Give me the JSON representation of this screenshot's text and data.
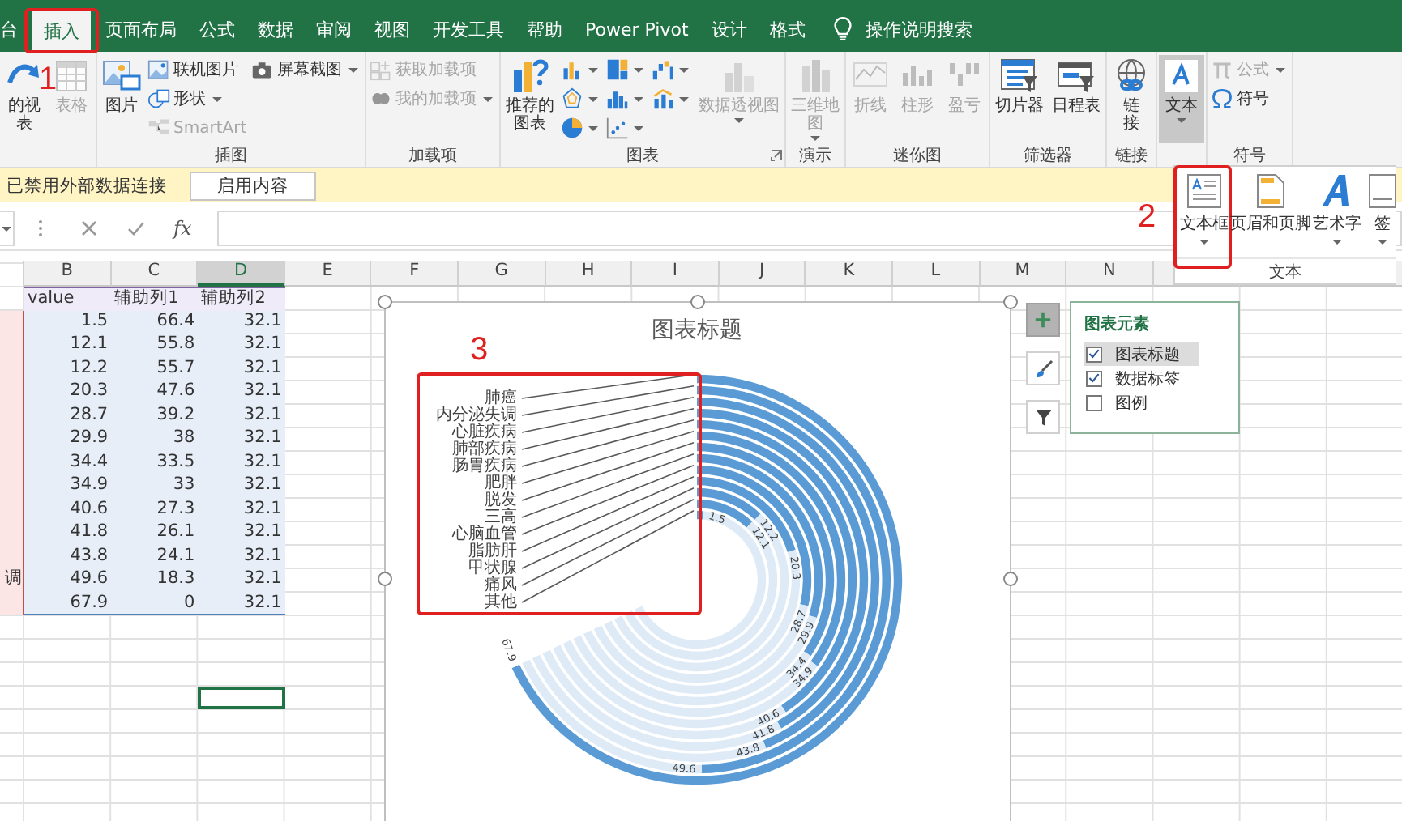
{
  "tabs": [
    {
      "label": "台",
      "selected": false
    },
    {
      "label": "插入",
      "selected": true
    },
    {
      "label": "页面布局",
      "selected": false
    },
    {
      "label": "公式",
      "selected": false
    },
    {
      "label": "数据",
      "selected": false
    },
    {
      "label": "审阅",
      "selected": false
    },
    {
      "label": "视图",
      "selected": false
    },
    {
      "label": "开发工具",
      "selected": false
    },
    {
      "label": "帮助",
      "selected": false
    },
    {
      "label": "Power Pivot",
      "selected": false
    },
    {
      "label": "设计",
      "selected": false
    },
    {
      "label": "格式",
      "selected": false
    }
  ],
  "tell_me": {
    "placeholder": "操作说明搜索"
  },
  "ribbon": {
    "groups": [
      {
        "launcher": false,
        "items": [
          {
            "kind": "large",
            "label": "的视表",
            "disabled": false,
            "pressed": false,
            "dropdown": false
          },
          {
            "kind": "large",
            "label": "表格",
            "disabled": true,
            "pressed": false,
            "dropdown": false
          }
        ]
      },
      {
        "label": "插图",
        "launcher": false,
        "items": [
          {
            "kind": "large",
            "label": "图片",
            "disabled": false,
            "pressed": false,
            "dropdown": false
          },
          {
            "kind": "small",
            "label": "联机图片",
            "disabled": false,
            "pressed": false,
            "dropdown": false
          },
          {
            "kind": "small",
            "label": "形状",
            "disabled": false,
            "pressed": false,
            "dropdown": true
          },
          {
            "kind": "small",
            "label": "SmartArt",
            "disabled": true,
            "pressed": false,
            "dropdown": false
          },
          {
            "kind": "small",
            "label": "屏幕截图",
            "disabled": false,
            "pressed": false,
            "dropdown": true
          }
        ]
      },
      {
        "label": "加载项",
        "launcher": false,
        "items": [
          {
            "kind": "small",
            "label": "获取加载项",
            "disabled": true,
            "pressed": false,
            "dropdown": false
          },
          {
            "kind": "small",
            "label": "我的加载项",
            "disabled": true,
            "pressed": false,
            "dropdown": true
          }
        ]
      },
      {
        "label": "图表",
        "launcher": true,
        "items": [
          {
            "kind": "large",
            "label": "推荐的图表",
            "disabled": false,
            "pressed": false,
            "dropdown": false
          },
          {
            "kind": "icon",
            "disabled": false,
            "pressed": false,
            "dropdown": true
          },
          {
            "kind": "icon",
            "disabled": false,
            "pressed": false,
            "dropdown": true
          },
          {
            "kind": "icon",
            "disabled": false,
            "pressed": false,
            "dropdown": true
          },
          {
            "kind": "icon",
            "disabled": false,
            "pressed": false,
            "dropdown": true
          },
          {
            "kind": "icon",
            "disabled": false,
            "pressed": false,
            "dropdown": true
          },
          {
            "kind": "icon",
            "disabled": false,
            "pressed": false,
            "dropdown": true
          },
          {
            "kind": "icon",
            "disabled": false,
            "pressed": false,
            "dropdown": true
          },
          {
            "kind": "icon",
            "disabled": false,
            "pressed": false,
            "dropdown": true
          },
          {
            "kind": "large",
            "label": "数据透视图",
            "disabled": true,
            "pressed": false,
            "dropdown": true
          }
        ]
      },
      {
        "label": "演示",
        "launcher": false,
        "items": [
          {
            "kind": "large",
            "label": "三维地图",
            "disabled": true,
            "pressed": false,
            "dropdown": true
          }
        ]
      },
      {
        "label": "迷你图",
        "launcher": false,
        "items": [
          {
            "kind": "large",
            "label": "折线",
            "disabled": true,
            "pressed": false,
            "dropdown": false
          },
          {
            "kind": "large",
            "label": "柱形",
            "disabled": true,
            "pressed": false,
            "dropdown": false
          },
          {
            "kind": "large",
            "label": "盈亏",
            "disabled": true,
            "pressed": false,
            "dropdown": false
          }
        ]
      },
      {
        "label": "筛选器",
        "launcher": false,
        "items": [
          {
            "kind": "large",
            "label": "切片器",
            "disabled": false,
            "pressed": false,
            "dropdown": false
          },
          {
            "kind": "large",
            "label": "日程表",
            "disabled": false,
            "pressed": false,
            "dropdown": false
          }
        ]
      },
      {
        "label": "链接",
        "launcher": false,
        "items": [
          {
            "kind": "large",
            "label": "链接",
            "disabled": false,
            "pressed": false,
            "dropdown": false
          }
        ]
      },
      {
        "launcher": false,
        "items": [
          {
            "kind": "large",
            "label": "文本",
            "disabled": false,
            "pressed": true,
            "dropdown": true
          }
        ]
      },
      {
        "label": "符号",
        "launcher": false,
        "items": [
          {
            "kind": "small",
            "label": "公式",
            "disabled": true,
            "pressed": false,
            "dropdown": true
          },
          {
            "kind": "small",
            "label": "符号",
            "disabled": false,
            "pressed": false,
            "dropdown": false
          }
        ]
      }
    ]
  },
  "text_gallery": {
    "label": "文本",
    "items": [
      {
        "label": "文本框",
        "dropdown": true
      },
      {
        "label": "页眉和页脚",
        "dropdown": false
      },
      {
        "label": "艺术字",
        "dropdown": true
      },
      {
        "label": "签",
        "dropdown": true
      }
    ]
  },
  "message_bar": {
    "text": "已禁用外部数据连接",
    "button": "启用内容"
  },
  "formula_bar": {
    "function_label": "fx"
  },
  "sheet": {
    "columns": [
      {
        "label": "B",
        "selected": false
      },
      {
        "label": "C",
        "selected": false
      },
      {
        "label": "D",
        "selected": true
      },
      {
        "label": "E",
        "selected": false
      },
      {
        "label": "F",
        "selected": false
      },
      {
        "label": "G",
        "selected": false
      },
      {
        "label": "H",
        "selected": false
      },
      {
        "label": "I",
        "selected": false
      },
      {
        "label": "J",
        "selected": false
      },
      {
        "label": "K",
        "selected": false
      },
      {
        "label": "L",
        "selected": false
      },
      {
        "label": "M",
        "selected": false
      },
      {
        "label": "N",
        "selected": false
      }
    ],
    "header_row": [
      "value",
      "辅助列1",
      "辅助列2"
    ],
    "rows": [
      {
        "cells": [
          "1.5",
          "66.4",
          "32.1"
        ]
      },
      {
        "cells": [
          "12.1",
          "55.8",
          "32.1"
        ]
      },
      {
        "cells": [
          "12.2",
          "55.7",
          "32.1"
        ]
      },
      {
        "cells": [
          "20.3",
          "47.6",
          "32.1"
        ]
      },
      {
        "cells": [
          "28.7",
          "39.2",
          "32.1"
        ]
      },
      {
        "cells": [
          "29.9",
          "38",
          "32.1"
        ]
      },
      {
        "cells": [
          "34.4",
          "33.5",
          "32.1"
        ]
      },
      {
        "cells": [
          "34.9",
          "33",
          "32.1"
        ]
      },
      {
        "cells": [
          "40.6",
          "27.3",
          "32.1"
        ]
      },
      {
        "cells": [
          "41.8",
          "26.1",
          "32.1"
        ]
      },
      {
        "cells": [
          "43.8",
          "24.1",
          "32.1"
        ]
      },
      {
        "column_a": "调",
        "cells": [
          "49.6",
          "18.3",
          "32.1"
        ]
      },
      {
        "cells": [
          "67.9",
          "0",
          "32.1"
        ]
      }
    ]
  },
  "chart": {
    "title": "图表标题",
    "rings": [
      {
        "label": "肺癌",
        "value_label": "67.9"
      },
      {
        "label": "内分泌失调",
        "value_label": "49.6"
      },
      {
        "label": "心脏疾病",
        "value_label": "43.8"
      },
      {
        "label": "肺部疾病",
        "value_label": "41.8"
      },
      {
        "label": "肠胃疾病",
        "value_label": "40.6"
      },
      {
        "label": "肥胖",
        "value_label": "34.9"
      },
      {
        "label": "脱发",
        "value_label": "34.4"
      },
      {
        "label": "三高",
        "value_label": "29.9"
      },
      {
        "label": "心脑血管",
        "value_label": "28.7"
      },
      {
        "label": "脂肪肝",
        "value_label": "20.3"
      },
      {
        "label": "甲状腺",
        "value_label": "12.2"
      },
      {
        "label": "痛风",
        "value_label": "12.1"
      },
      {
        "label": "其他",
        "value_label": "1.5"
      }
    ]
  },
  "chart_buttons": [
    {
      "selected": true
    },
    {
      "selected": false
    },
    {
      "selected": false
    }
  ],
  "chart_elements": {
    "title": "图表元素",
    "items": [
      {
        "label": "图表标题",
        "checked": true,
        "selected": true
      },
      {
        "label": "数据标签",
        "checked": true,
        "selected": false
      },
      {
        "label": "图例",
        "checked": false,
        "selected": false
      }
    ]
  },
  "annotations": [
    {
      "label": "1"
    },
    {
      "label": "2"
    },
    {
      "label": "3"
    }
  ]
}
